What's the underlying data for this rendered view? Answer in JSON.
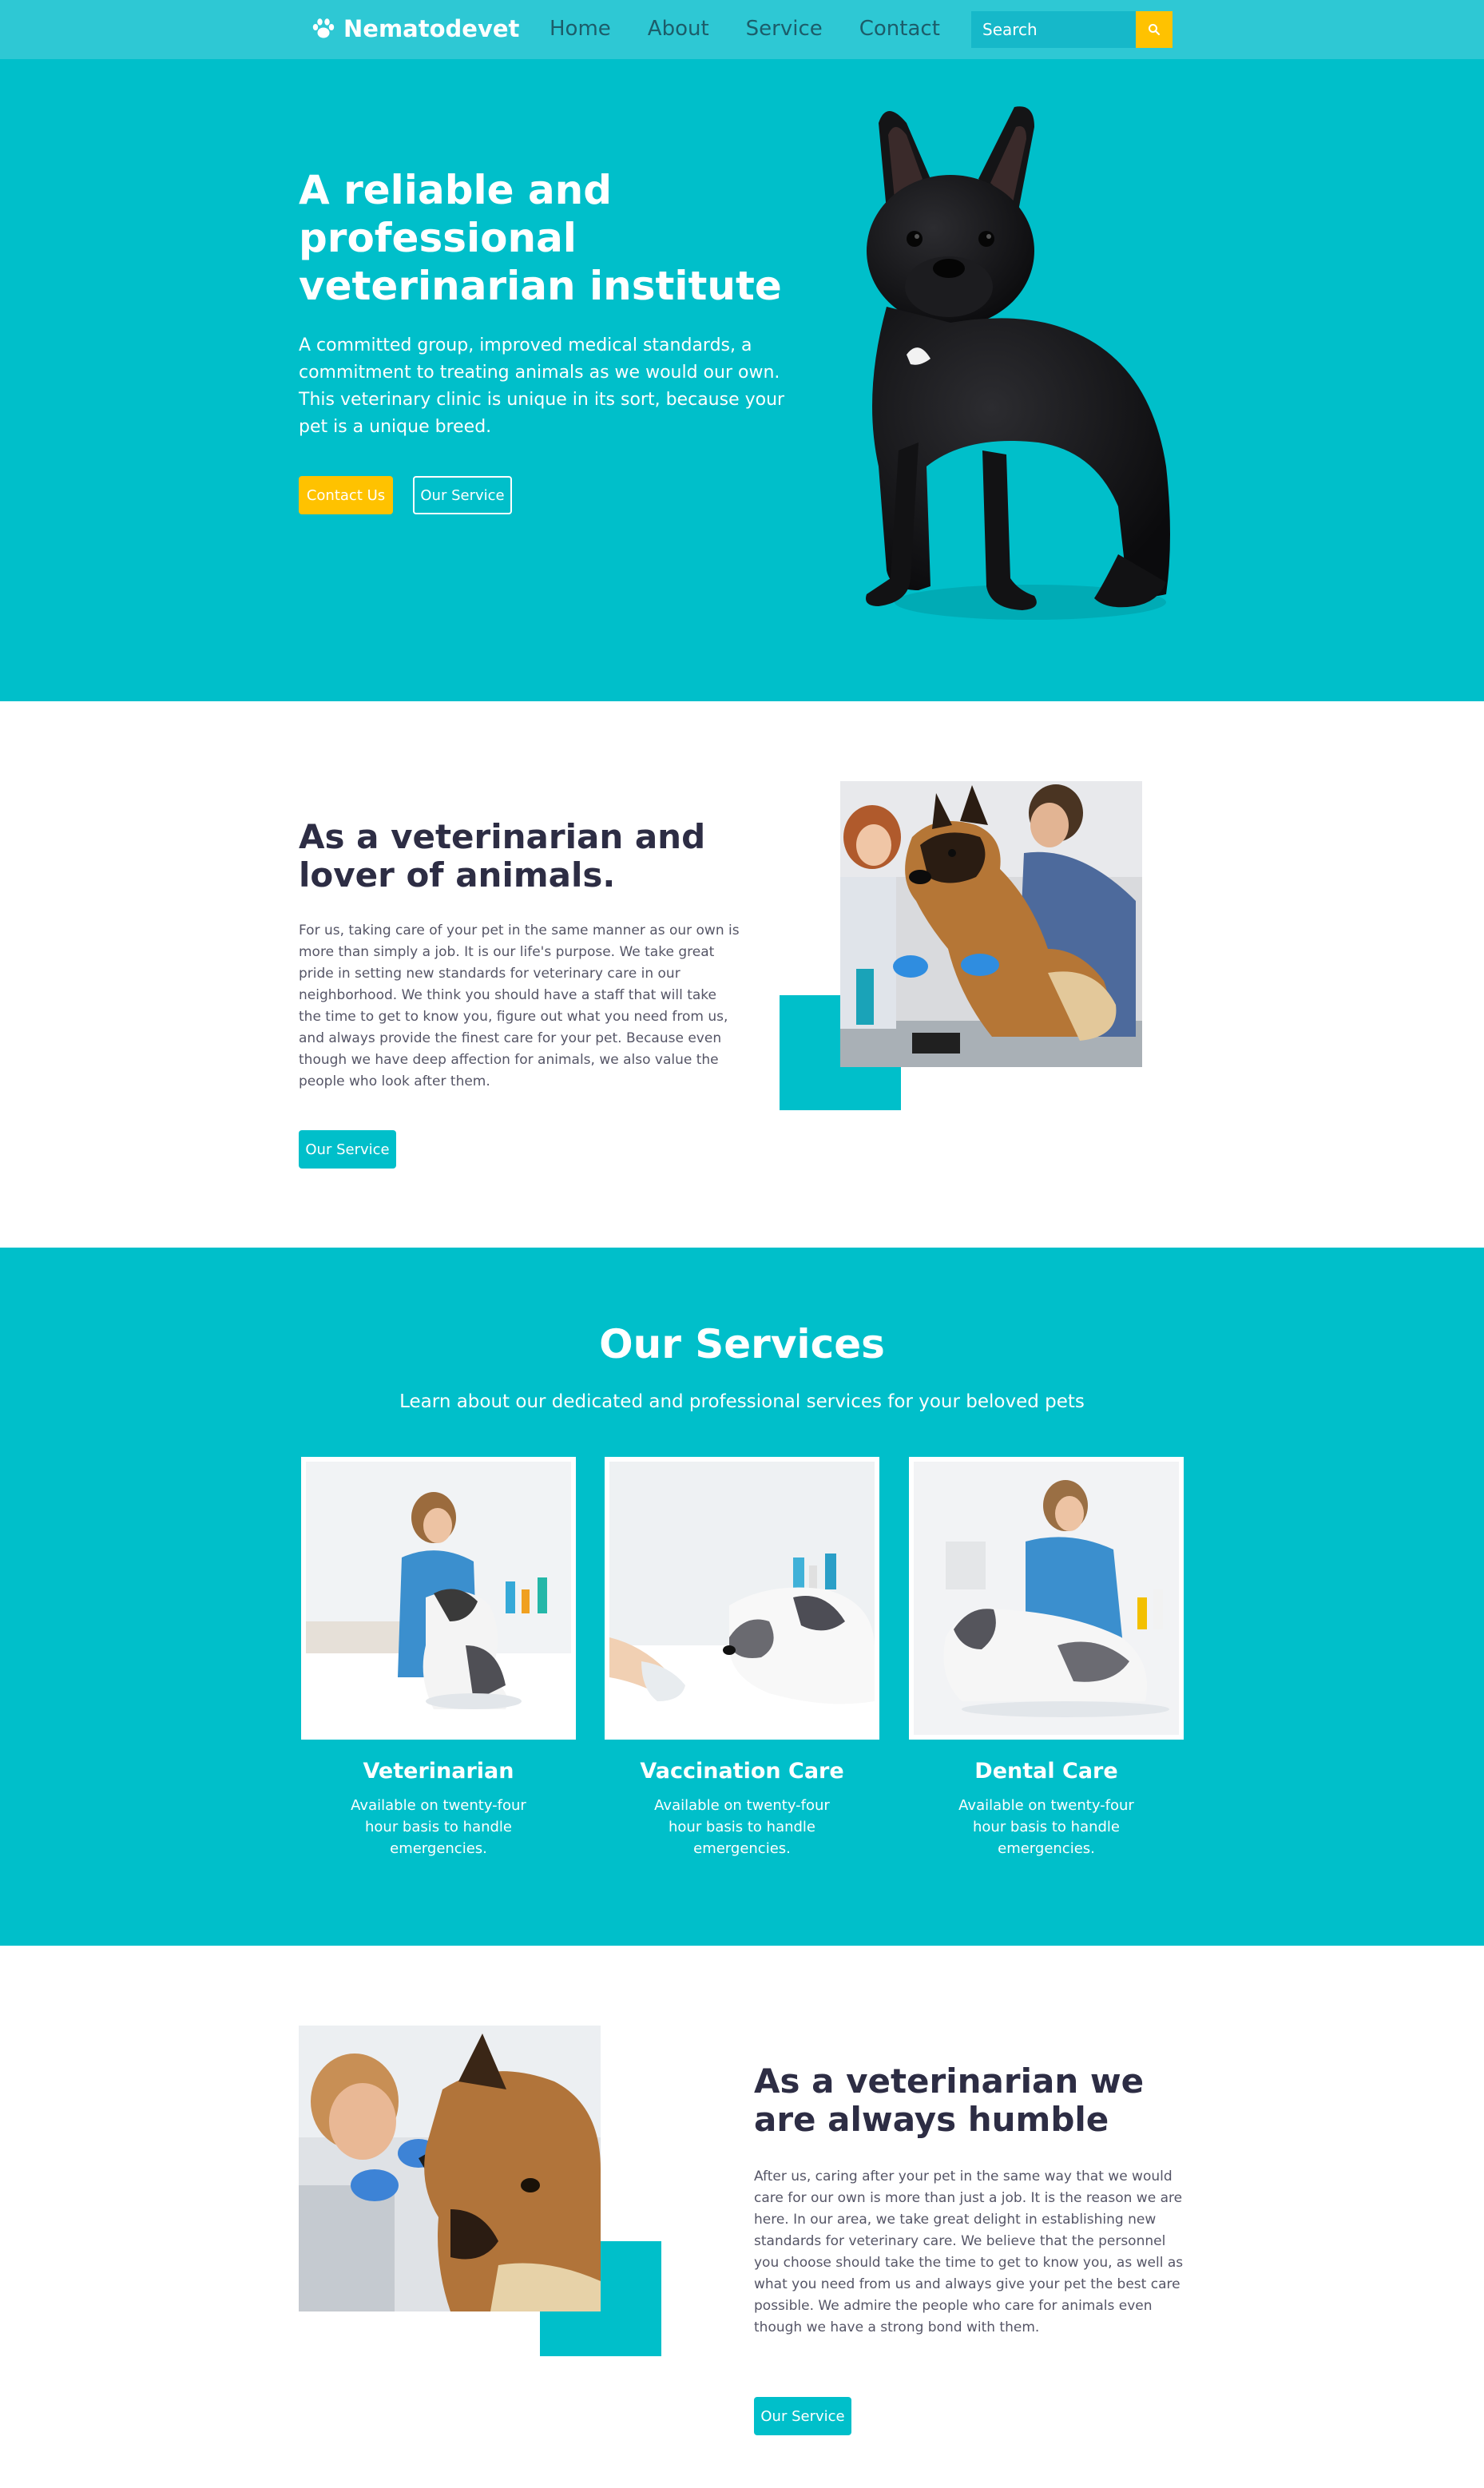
{
  "nav": {
    "brand": "Nematodevet",
    "links": [
      "Home",
      "About",
      "Service",
      "Contact"
    ],
    "search_placeholder": "Search"
  },
  "hero": {
    "title": "A reliable and professional veterinarian institute",
    "text": "A committed group, improved medical standards, a commitment to treating animals as we would our own. This veterinary clinic is unique in its sort, because your pet is a unique breed.",
    "primary_button": "Contact Us",
    "secondary_button": "Our Service"
  },
  "about": {
    "title": "As a veterinarian and lover of animals.",
    "text": "For us, taking care of your pet in the same manner as our own is more than simply a job. It is our life's purpose. We take great pride in setting new standards for veterinary care in our neighborhood. We think you should have a staff that will take the time to get to know you, figure out what you need from us, and always provide the finest care for your pet. Because even though we have deep affection for animals, we also value the people who look after them.",
    "button": "Our Service"
  },
  "services": {
    "title": "Our Services",
    "subtitle": "Learn about our dedicated and professional services for your beloved pets",
    "cards": [
      {
        "title": "Veterinarian",
        "text": "Available on twenty-four hour basis to handle emergencies."
      },
      {
        "title": "Vaccination Care",
        "text": "Available on twenty-four hour basis to handle emergencies."
      },
      {
        "title": "Dental Care",
        "text": "Available on twenty-four hour basis to handle emergencies."
      }
    ]
  },
  "humble": {
    "title": "As a veterinarian we are always humble",
    "text": "After us, caring after your pet in the same way that we would care for our own is more than just a job. It is the reason we are here. In our area, we take great delight in establishing new standards for veterinary care. We believe that the personnel you choose should take the time to get to know you, as well as what you need from us and always give your pet the best care possible. We admire the people who care for animals even though we have a strong bond with them.",
    "button": "Our Service"
  },
  "colors": {
    "teal": "#00bfca",
    "nav": "#2ec8d4",
    "yellow": "#ffc200",
    "heading": "#2d2d44"
  },
  "icons": [
    "paw-icon",
    "search-icon"
  ]
}
